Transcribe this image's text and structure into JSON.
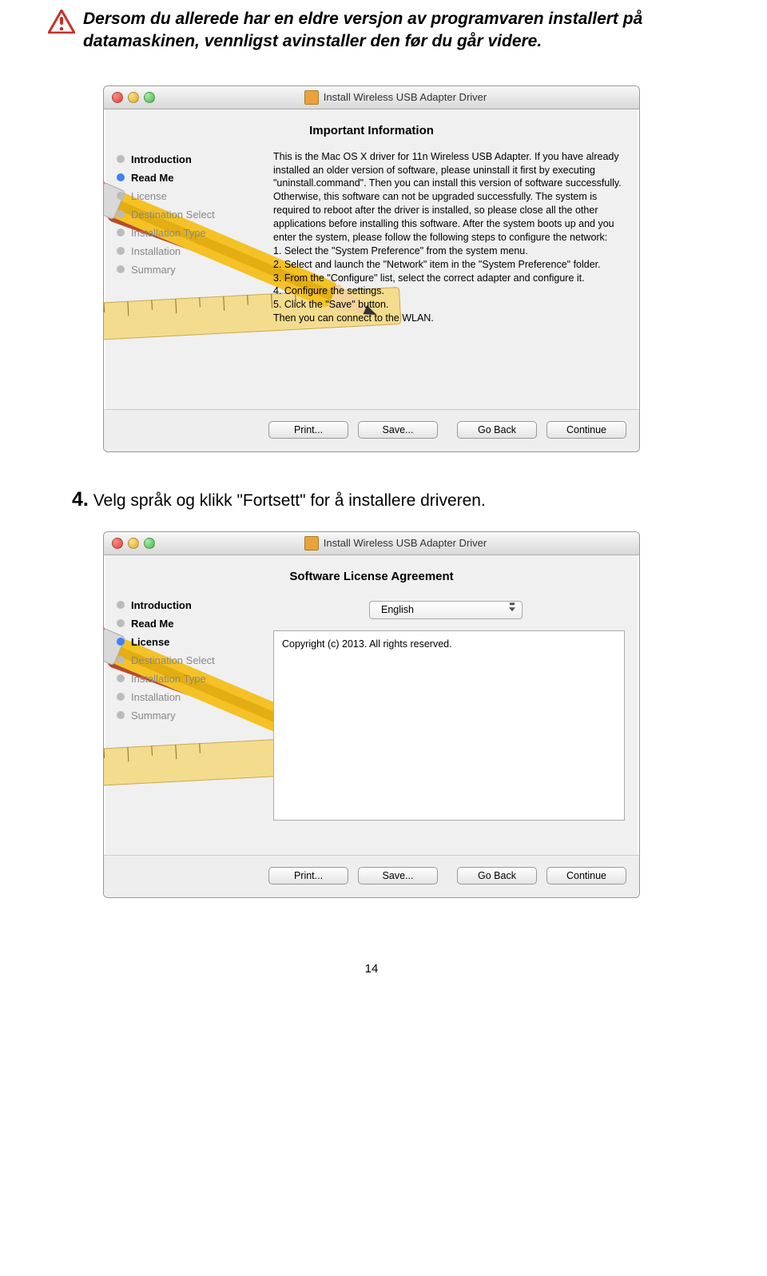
{
  "warning_text": "Dersom du allerede har en eldre versjon av programvaren installert på datamaskinen, vennligst avinstaller den før du går videre.",
  "step4_num": "4.",
  "step4_text": " Velg språk og klikk \"Fortsett\" for å installere driveren.",
  "page_number": "14",
  "installer1": {
    "title": "Install Wireless USB Adapter Driver",
    "heading": "Important Information",
    "sidebar": [
      {
        "label": "Introduction",
        "state": "done"
      },
      {
        "label": "Read Me",
        "state": "current"
      },
      {
        "label": "License",
        "state": "future"
      },
      {
        "label": "Destination Select",
        "state": "future"
      },
      {
        "label": "Installation Type",
        "state": "future"
      },
      {
        "label": "Installation",
        "state": "future"
      },
      {
        "label": "Summary",
        "state": "future"
      }
    ],
    "content_lines": [
      "This is the Mac OS X driver for 11n Wireless USB Adapter. If you have already installed an older version of software, please uninstall it first by executing \"uninstall.command\". Then you can install this version of software successfully. Otherwise, this software can not be upgraded successfully. The system is required to reboot after the driver is installed, so please close all the other applications before installing this software. After the system boots up and you enter the system, please follow the following steps to configure the network:",
      "1. Select the \"System Preference\" from the system menu.",
      "2. Select and launch the \"Network\" item in the \"System Preference\" folder.",
      "3. From the \"Configure\" list, select the correct adapter and configure it.",
      "4. Configure the settings.",
      "5. Click the \"Save\" button.",
      "Then you can connect to the WLAN."
    ],
    "buttons": {
      "print": "Print...",
      "save": "Save...",
      "back": "Go Back",
      "cont": "Continue"
    }
  },
  "installer2": {
    "title": "Install Wireless USB Adapter Driver",
    "heading": "Software License Agreement",
    "sidebar": [
      {
        "label": "Introduction",
        "state": "done"
      },
      {
        "label": "Read Me",
        "state": "done"
      },
      {
        "label": "License",
        "state": "current"
      },
      {
        "label": "Destination Select",
        "state": "future"
      },
      {
        "label": "Installation Type",
        "state": "future"
      },
      {
        "label": "Installation",
        "state": "future"
      },
      {
        "label": "Summary",
        "state": "future"
      }
    ],
    "language": "English",
    "copyright": "Copyright (c) 2013.  All rights reserved.",
    "buttons": {
      "print": "Print...",
      "save": "Save...",
      "back": "Go Back",
      "cont": "Continue"
    }
  }
}
